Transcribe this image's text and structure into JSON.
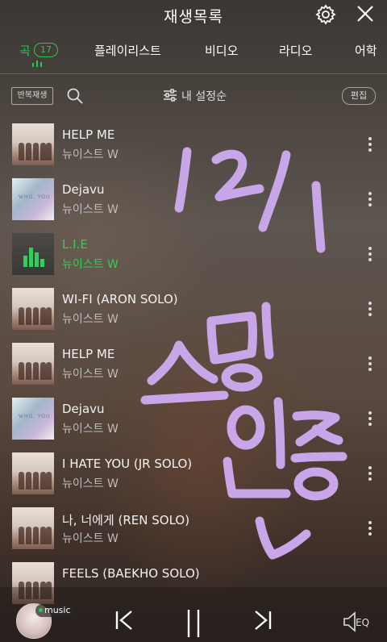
{
  "header": {
    "title": "재생목록"
  },
  "tabs": [
    {
      "label": "곡",
      "count": "17",
      "active": true
    },
    {
      "label": "플레이리스트"
    },
    {
      "label": "비디오"
    },
    {
      "label": "라디오"
    },
    {
      "label": "어학"
    }
  ],
  "toolbar": {
    "repeat_label": "반복재생",
    "sort_label": "내 설정순",
    "edit_label": "편집"
  },
  "tracks": [
    {
      "title": "HELP ME",
      "artist": "뉴이스트 W",
      "art": "group-photo"
    },
    {
      "title": "Dejavu",
      "artist": "뉴이스트 W",
      "art": "who-you"
    },
    {
      "title": "L.I.E",
      "artist": "뉴이스트 W",
      "art": "now-playing",
      "playing": true
    },
    {
      "title": "WI-FI (ARON SOLO)",
      "artist": "뉴이스트 W",
      "art": "group-photo"
    },
    {
      "title": "HELP ME",
      "artist": "뉴이스트 W",
      "art": "group-photo"
    },
    {
      "title": "Dejavu",
      "artist": "뉴이스트 W",
      "art": "who-you"
    },
    {
      "title": "I HATE YOU (JR SOLO)",
      "artist": "뉴이스트 W",
      "art": "group-photo"
    },
    {
      "title": "나, 너에게 (REN SOLO)",
      "artist": "뉴이스트 W",
      "art": "group-photo"
    },
    {
      "title": "FEELS (BAEKHO SOLO)",
      "artist": "",
      "art": "group-photo"
    }
  ],
  "album_art_text": "WHO, YOU",
  "handwriting": {
    "text": "12/1 스밍인증",
    "color": "#c9a6e8"
  },
  "player": {
    "tag": "music",
    "eq_label": "EQ"
  },
  "colors": {
    "accent": "#26c94f",
    "handwriting": "#c9a6e8"
  }
}
